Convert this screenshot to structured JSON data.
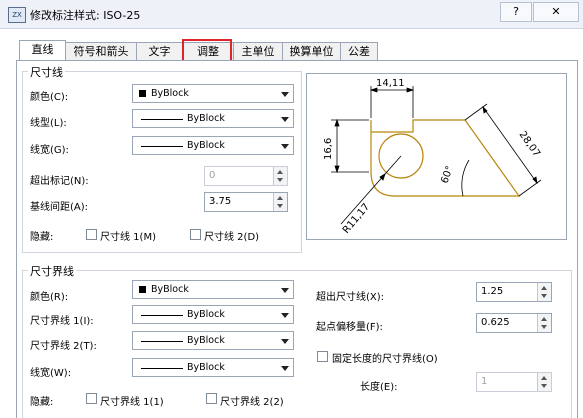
{
  "window": {
    "title": "修改标注样式: ISO-25",
    "icon_text": "ZX",
    "help_label": "?",
    "close_label": "✕"
  },
  "tabs": [
    {
      "label": "直线",
      "active": true
    },
    {
      "label": "符号和箭头",
      "active": false
    },
    {
      "label": "文字",
      "active": false
    },
    {
      "label": "调整",
      "active": false,
      "highlighted": true
    },
    {
      "label": "主单位",
      "active": false
    },
    {
      "label": "换算单位",
      "active": false
    },
    {
      "label": "公差",
      "active": false
    }
  ],
  "dim_lines": {
    "title": "尺寸线",
    "color_label": "颜色(C):",
    "color_value": "ByBlock",
    "linetype_label": "线型(L):",
    "linetype_value": "ByBlock",
    "lineweight_label": "线宽(G):",
    "lineweight_value": "ByBlock",
    "extend_beyond_ticks_label": "超出标记(N):",
    "extend_beyond_ticks_value": "0",
    "baseline_spacing_label": "基线间距(A):",
    "baseline_spacing_value": "3.75",
    "suppress_label": "隐藏:",
    "suppress_1_label": "尺寸线 1(M)",
    "suppress_2_label": "尺寸线 2(D)"
  },
  "ext_lines": {
    "title": "尺寸界线",
    "color_label": "颜色(R):",
    "color_value": "ByBlock",
    "linetype1_label": "尺寸界线 1(I):",
    "linetype1_value": "ByBlock",
    "linetype2_label": "尺寸界线 2(T):",
    "linetype2_value": "ByBlock",
    "lineweight_label": "线宽(W):",
    "lineweight_value": "ByBlock",
    "suppress_label": "隐藏:",
    "suppress_1_label": "尺寸界线 1(1)",
    "suppress_2_label": "尺寸界线 2(2)",
    "extend_beyond_label": "超出尺寸线(X):",
    "extend_beyond_value": "1.25",
    "offset_label": "起点偏移量(F):",
    "offset_value": "0.625",
    "fixed_length_label": "固定长度的尺寸界线(O)",
    "length_label": "长度(E):",
    "length_value": "1"
  },
  "preview": {
    "dim_top": "14,11",
    "dim_left": "16,6",
    "dim_right": "28,07",
    "dim_angle": "60°",
    "dim_radius": "R11,17"
  },
  "colors": {
    "geometry": "#b8860b",
    "highlight": "#e0252a",
    "dimension": "#000000"
  }
}
